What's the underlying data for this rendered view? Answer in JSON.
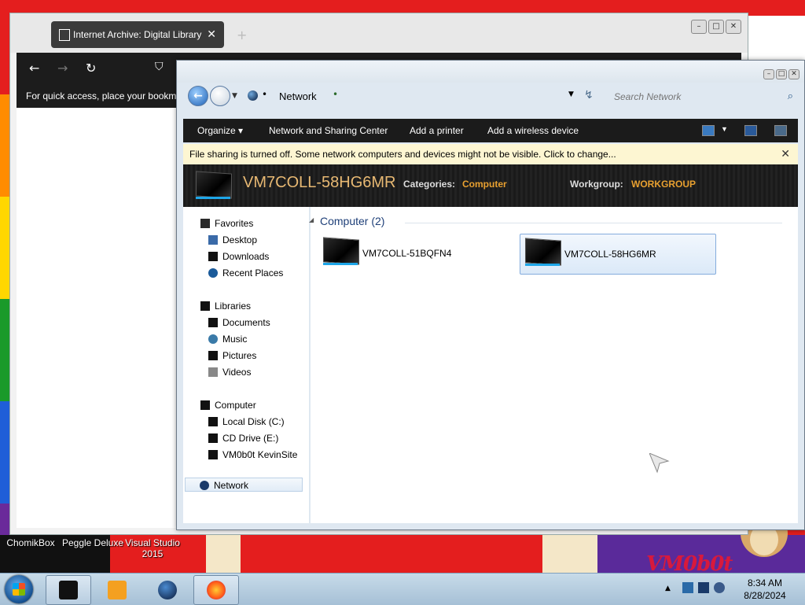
{
  "browser": {
    "tab_title": "Internet Archive: Digital Library",
    "tab_close": "✕",
    "new_tab": "+",
    "bookmarks_hint": "For quick access, place your bookma"
  },
  "explorer": {
    "address": "Network",
    "search_placeholder": "Search Network",
    "toolbar": {
      "organize": "Organize",
      "network_sharing": "Network and Sharing Center",
      "add_printer": "Add a printer",
      "add_wireless": "Add a wireless device"
    },
    "infobar": "File sharing is turned off. Some network computers and devices might not be visible. Click to change...",
    "details": {
      "name": "VM7COLL-58HG6MR",
      "categories_label": "Categories:",
      "categories_value": "Computer",
      "workgroup_label": "Workgroup:",
      "workgroup_value": "WORKGROUP"
    },
    "nav": {
      "favorites": "Favorites",
      "desktop": "Desktop",
      "downloads": "Downloads",
      "recent": "Recent Places",
      "libraries": "Libraries",
      "documents": "Documents",
      "music": "Music",
      "pictures": "Pictures",
      "videos": "Videos",
      "computer": "Computer",
      "local_disk": "Local Disk (C:)",
      "cd_drive": "CD Drive (E:)",
      "site": "VM0b0t KevinSite",
      "network": "Network"
    },
    "group_header": "Computer (2)",
    "computers": [
      "VM7COLL-51BQFN4",
      "VM7COLL-58HG6MR"
    ]
  },
  "desktop": {
    "icons": [
      "ChomikBox",
      "Peggle Deluxe",
      "Visual Studio 2015"
    ],
    "logo": "VM0b0t"
  },
  "taskbar": {
    "time": "8:34 AM",
    "date": "8/28/2024"
  }
}
